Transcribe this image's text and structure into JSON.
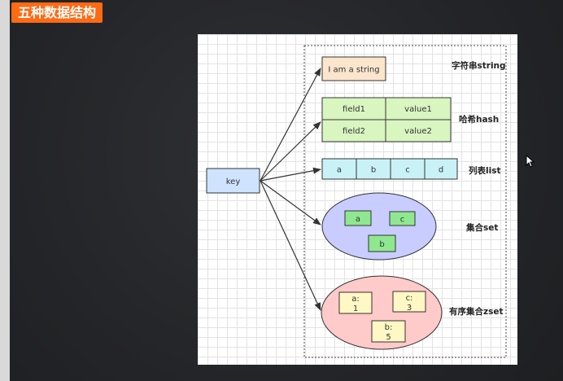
{
  "header": {
    "title": "五种数据结构"
  },
  "diagram": {
    "key": {
      "label": "key"
    },
    "string": {
      "value": "I am a string",
      "label": "字符串string"
    },
    "hash": {
      "rows": [
        {
          "field": "field1",
          "value": "value1"
        },
        {
          "field": "field2",
          "value": "value2"
        }
      ],
      "label": "哈希hash"
    },
    "list": {
      "items": [
        "a",
        "b",
        "c",
        "d"
      ],
      "label": "列表list"
    },
    "set": {
      "items": [
        "a",
        "c",
        "b"
      ],
      "label": "集合set"
    },
    "zset": {
      "items": [
        {
          "member": "a:",
          "score": "1"
        },
        {
          "member": "c:",
          "score": "3"
        },
        {
          "member": "b:",
          "score": "5"
        }
      ],
      "label": "有序集合zset"
    }
  },
  "colors": {
    "badge": "#ff6a13",
    "key_fill": "#cfe3ff",
    "string_fill": "#fce5cd",
    "hash_fill": "#d9f5c0",
    "list_fill": "#c9f2f7",
    "set_fill": "#c9ccff",
    "set_item_fill": "#8fe88f",
    "zset_fill": "#ffcaca",
    "zset_item_fill": "#fff8c4"
  }
}
